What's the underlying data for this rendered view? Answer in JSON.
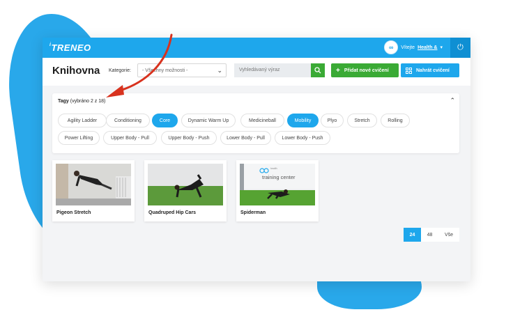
{
  "app": {
    "logo": "TRENEO",
    "logo_prefix": "i"
  },
  "topbar": {
    "greeting": "Vítejte",
    "user_name": "Health &",
    "user_caret": "▾",
    "avatar_icon": "health-logo-icon",
    "power_icon": "⏻"
  },
  "header": {
    "title": "Knihovna",
    "category_label": "Kategorie:",
    "category_value": "- Všechny možnosti -",
    "search_placeholder": "Vyhledávaný výraz",
    "add_label": "Přidat nové cvičení",
    "upload_label": "Nahrát cvičení"
  },
  "tags": {
    "title": "Tagy",
    "selected_info": "(vybráno 2 z 18)",
    "items": [
      {
        "label": "Agility Ladder",
        "active": false
      },
      {
        "label": "Conditioning",
        "active": false
      },
      {
        "label": "Core",
        "active": true
      },
      {
        "label": "Dynamic Warm Up",
        "active": false
      },
      {
        "label": "Medicineball",
        "active": false
      },
      {
        "label": "Mobility",
        "active": true
      },
      {
        "label": "Plyo",
        "active": false
      },
      {
        "label": "Stretch",
        "active": false
      },
      {
        "label": "Rolling",
        "active": false
      },
      {
        "label": "Power Lifting",
        "active": false
      },
      {
        "label": "Upper Body - Pull",
        "active": false
      },
      {
        "label": "Upper Body - Push",
        "active": false
      },
      {
        "label": "Lower Body - Pull",
        "active": false
      },
      {
        "label": "Lower Body - Push",
        "active": false
      }
    ]
  },
  "exercises": [
    {
      "title": "Pigeon Stretch"
    },
    {
      "title": "Quadruped Hip Cars"
    },
    {
      "title": "Spiderman"
    }
  ],
  "thumb_texts": {
    "brand": "training center",
    "brand_small": "health"
  },
  "pagination": [
    {
      "label": "24",
      "active": true
    },
    {
      "label": "48",
      "active": false
    },
    {
      "label": "Vše",
      "active": false
    }
  ],
  "colors": {
    "accent": "#1ea7ec",
    "green": "#3aaa35",
    "arrow": "#d8321e"
  }
}
